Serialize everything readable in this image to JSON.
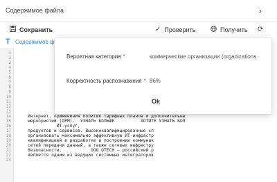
{
  "header": {
    "title": "Содержимое файла"
  },
  "toolbar": {
    "save_label": "Сохранить",
    "check_label": "Проверить",
    "get_label": "Получить"
  },
  "editor_tab": {
    "label": "Содержимое ф"
  },
  "editor": {
    "line_numbers": [
      "1",
      "2",
      "3",
      "4",
      "5",
      "6",
      "7",
      "8",
      "9",
      "10",
      "11",
      "12",
      "13",
      "14",
      "15",
      "16",
      "17",
      "18",
      "19",
      "20",
      "21",
      "22",
      "23"
    ],
    "visible_lines": [
      {
        "n": 14,
        "text": "Интернет, применения политик тарифных планов и дополнительны"
      },
      {
        "n": 15,
        "text": "мероприятий (ОРМ).  УЗНАТЬ БОЛЬШЕ          ХОТИТЕ УЗНАТЬ БОЛ"
      },
      {
        "n": 16,
        "text": "           ИТ-услуг,"
      },
      {
        "n": 17,
        "text": "продуктов и сервисов. Высококвалифицированные сп"
      },
      {
        "n": 18,
        "text": "организовать максимально эффективную ИТ-инфрастр"
      },
      {
        "n": 19,
        "text": "квалификацией в разработке и построении коммуник"
      },
      {
        "n": 20,
        "text": "сетей передачи данный, а также сетевых инфрастру"
      },
      {
        "n": 21,
        "text": "безопасности.           OOO QTECH — российский р"
      },
      {
        "n": 22,
        "text": "является одним из ведущих системных интеграторов"
      }
    ]
  },
  "modal": {
    "category_label": "Вероятная категория",
    "category_value": "коммерческие организации (organizations",
    "accuracy_label": "Корректность распознавания",
    "accuracy_value": "86%",
    "ok_label": "Ok"
  }
}
